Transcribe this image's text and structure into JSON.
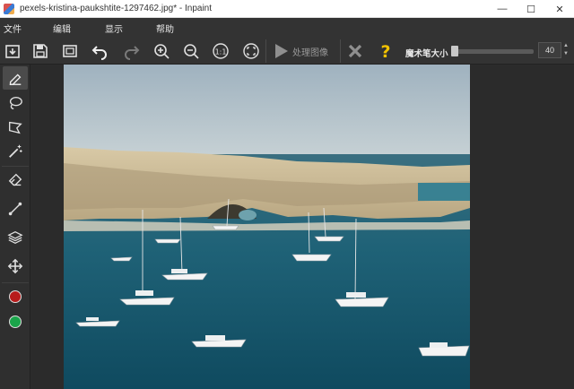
{
  "window": {
    "title": "pexels-kristina-paukshtite-1297462.jpg* - Inpaint",
    "minimize_symbol": "—",
    "maximize_symbol": "☐",
    "close_symbol": "✕"
  },
  "menu": {
    "file": "文件",
    "edit": "编辑",
    "view": "显示",
    "help": "帮助"
  },
  "toolbar": {
    "process_label": "处理图像",
    "brush_size_label": "魔术笔大小",
    "brush_size_value": "40",
    "brush_size_fraction": 0.06,
    "icons": [
      "open-icon",
      "save-icon",
      "save-as-icon",
      "undo-icon",
      "redo-icon",
      "zoom-in-icon",
      "zoom-out-icon",
      "actual-size-icon",
      "fit-screen-icon",
      "play-icon",
      "cancel-icon",
      "help-icon"
    ]
  },
  "sidebar": {
    "tools": [
      "marker-tool",
      "lasso-tool",
      "polygon-lasso-tool",
      "magic-wand-tool",
      "eraser-tool",
      "line-tool",
      "layers-tool",
      "move-tool"
    ],
    "active_tool": "marker-tool",
    "color_primary": "#b71c1c",
    "color_secondary": "#1aa54a"
  },
  "colors": {
    "titlebar_bg": "#ffffff",
    "chrome_bg": "#333333",
    "canvas_bg": "#2b2b2b",
    "icon_color": "#e0e0e0",
    "help_yellow": "#f2c200"
  }
}
